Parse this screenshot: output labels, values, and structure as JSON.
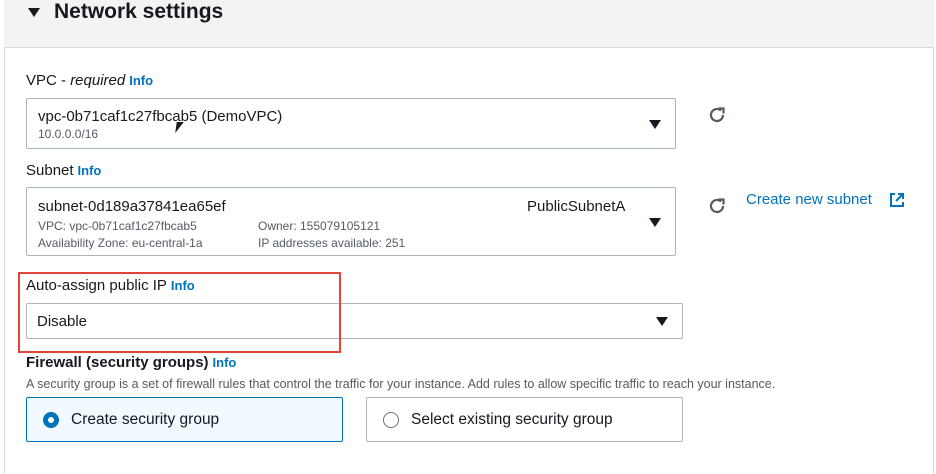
{
  "section": {
    "title": "Network settings"
  },
  "vpc": {
    "label": "VPC - ",
    "required": "required",
    "info": "Info",
    "selected_name": "vpc-0b71caf1c27fbcab5 (DemoVPC)",
    "selected_cidr": "10.0.0.0/16"
  },
  "subnet": {
    "label": "Subnet",
    "info": "Info",
    "selected_id": "subnet-0d189a37841ea65ef",
    "selected_name": "PublicSubnetA",
    "vpc_line": "VPC: vpc-0b71caf1c27fbcab5",
    "owner_line": "Owner: 155079105121",
    "az_line": "Availability Zone: eu-central-1a",
    "ips_line": "IP addresses available: 251",
    "create_link": "Create new subnet"
  },
  "auto_ip": {
    "label": "Auto-assign public IP",
    "info": "Info",
    "selected": "Disable"
  },
  "firewall": {
    "label": "Firewall (security groups)",
    "info": "Info",
    "description": "A security group is a set of firewall rules that control the traffic for your instance. Add rules to allow specific traffic to reach your instance.",
    "options": [
      "Create security group",
      "Select existing security group"
    ],
    "selected_index": 0
  },
  "colors": {
    "link": "#0073bb",
    "highlight": "#e2443b",
    "selected_tile_bg": "#f1faff"
  }
}
